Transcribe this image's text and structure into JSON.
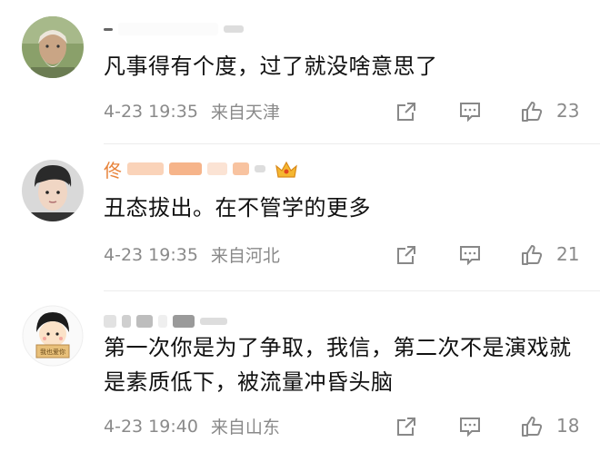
{
  "comments": [
    {
      "text": "凡事得有个度，过了就没啥意思了",
      "time": "4-23 19:35",
      "location": "来自天津",
      "likes": "23",
      "name_first_char": ""
    },
    {
      "text": "丑态拔出。在不管学的更多",
      "time": "4-23 19:35",
      "location": "来自河北",
      "likes": "21",
      "name_first_char": "佟"
    },
    {
      "text": "第一次你是为了争取，我信，第二次不是演戏就是素质低下，被流量冲昏头脑",
      "time": "4-23 19:40",
      "location": "来自山东",
      "likes": "18",
      "name_first_char": ""
    }
  ],
  "avatar3_label": "我也爱你"
}
